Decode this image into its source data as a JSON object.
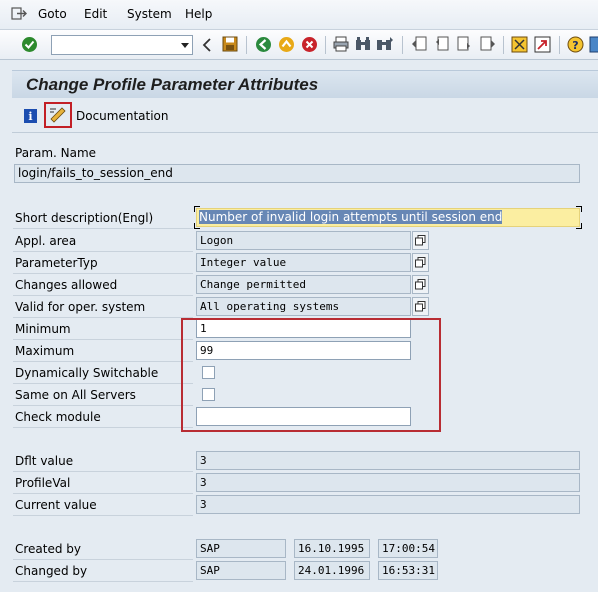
{
  "menu": {
    "items": [
      "Goto",
      "Edit",
      "System",
      "Help"
    ]
  },
  "toolbar": {
    "command_value": "",
    "icons": [
      "enter-icon",
      "back-icon",
      "save-icon",
      "exit-icon",
      "up-icon",
      "cancel-icon",
      "print-icon",
      "find-icon",
      "find-next-icon",
      "first-page-icon",
      "prev-page-icon",
      "next-page-icon",
      "last-page-icon",
      "create-session-icon",
      "shortcut-icon",
      "help-icon",
      "layout-icon"
    ]
  },
  "title": "Change Profile Parameter Attributes",
  "app_toolbar": {
    "documentation_label": "Documentation"
  },
  "fields": {
    "param_name_label": "Param. Name",
    "param_name_value": "login/fails_to_session_end",
    "short_desc_label": "Short description(Engl)",
    "short_desc_value": "Number of invalid login attempts until session end",
    "appl_area_label": "Appl. area",
    "appl_area_value": "Logon",
    "param_type_label": "ParameterTyp",
    "param_type_value": "Integer value",
    "changes_allowed_label": "Changes allowed",
    "changes_allowed_value": "Change permitted",
    "valid_os_label": "Valid for oper. system",
    "valid_os_value": "All operating systems",
    "minimum_label": "Minimum",
    "minimum_value": "1",
    "maximum_label": "Maximum",
    "maximum_value": "99",
    "dyn_switch_label": "Dynamically Switchable",
    "same_servers_label": "Same on All Servers",
    "check_module_label": "Check module",
    "check_module_value": "",
    "dflt_label": "Dflt value",
    "dflt_value": "3",
    "profile_val_label": "ProfileVal",
    "profile_val_value": "3",
    "current_label": "Current value",
    "current_value": "3",
    "created_by_label": "Created by",
    "created_by_user": "SAP",
    "created_by_date": "16.10.1995",
    "created_by_time": "17:00:54",
    "changed_by_label": "Changed by",
    "changed_by_user": "SAP",
    "changed_by_date": "24.01.1996",
    "changed_by_time": "16:53:31"
  },
  "colors": {
    "highlight_box": "#b82c33",
    "yellow_field": "#fbeea1",
    "selection": "#6787b5"
  }
}
